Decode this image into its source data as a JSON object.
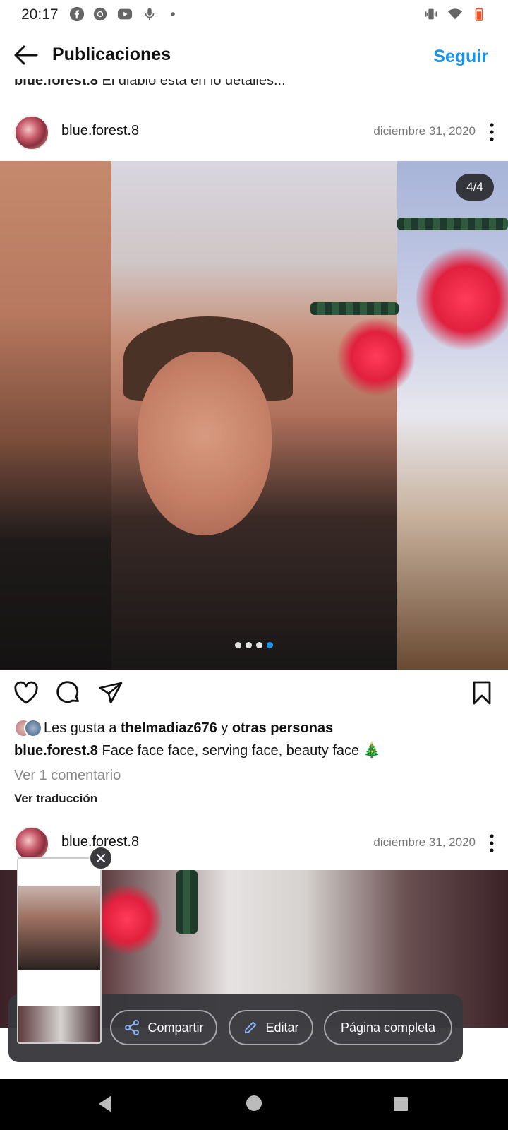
{
  "status_bar": {
    "time": "20:17",
    "icons_left": [
      "facebook-icon",
      "chrome-icon",
      "youtube-icon",
      "mic-icon",
      "dot-icon"
    ],
    "icons_right": [
      "vibrate-icon",
      "wifi-icon",
      "battery-icon"
    ]
  },
  "header": {
    "title": "Publicaciones",
    "follow_label": "Seguir"
  },
  "previous_caption": {
    "username": "blue.forest.8",
    "text": "El diablo está en lo detalles..."
  },
  "post": {
    "username": "blue.forest.8",
    "date": "diciembre 31, 2020",
    "counter": "4/4",
    "carousel": {
      "total": 4,
      "active_index": 3
    },
    "likes_prefix": "Les gusta a",
    "likes_user": "thelmadiaz676",
    "likes_join": "y",
    "likes_others": "otras personas",
    "caption_user": "blue.forest.8",
    "caption_text": "Face face face, serving face, beauty face 🎄",
    "view_comments": "Ver 1 comentario",
    "see_translation": "Ver traducción"
  },
  "post2": {
    "username": "blue.forest.8",
    "date": "diciembre 31, 2020"
  },
  "screenshot_toolbar": {
    "share_label": "Compartir",
    "edit_label": "Editar",
    "full_page_label": "Página completa"
  },
  "colors": {
    "accent": "#1a93e8",
    "overlay": "#37373c"
  }
}
